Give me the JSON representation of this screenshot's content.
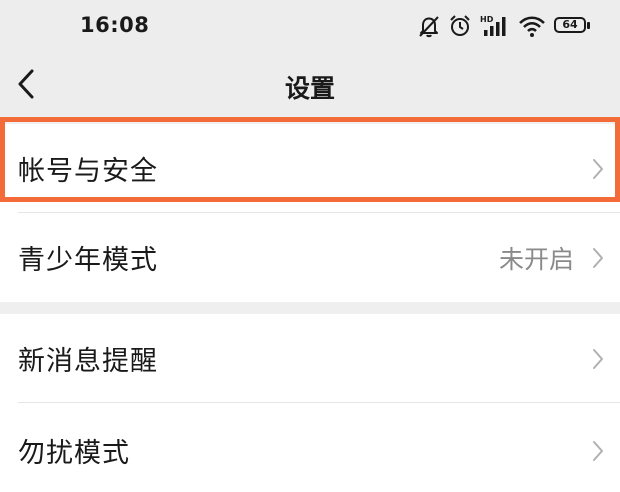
{
  "status_bar": {
    "time": "16:08",
    "battery": "64",
    "icons": [
      "mute-bell-icon",
      "alarm-icon",
      "hd-signal-icon",
      "wifi-icon",
      "battery-icon"
    ]
  },
  "header": {
    "title": "设置",
    "back_icon": "chevron-left-icon"
  },
  "settings": {
    "group1": [
      {
        "label": "帐号与安全",
        "value": ""
      },
      {
        "label": "青少年模式",
        "value": "未开启"
      }
    ],
    "group2": [
      {
        "label": "新消息提醒",
        "value": ""
      },
      {
        "label": "勿扰模式",
        "value": ""
      }
    ]
  },
  "highlight_color": "#f26b38"
}
